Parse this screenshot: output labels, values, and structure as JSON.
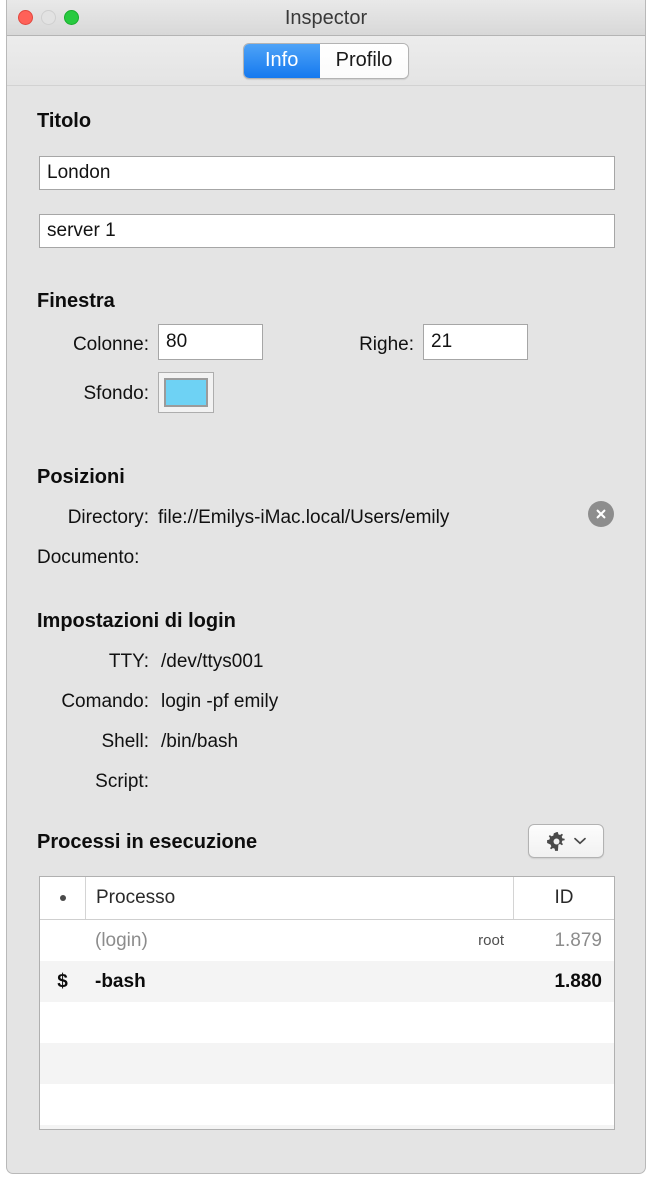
{
  "window": {
    "title": "Inspector",
    "controls": {
      "close": "close-button",
      "minimize": "minimize-button",
      "zoom": "zoom-button"
    }
  },
  "tabs": [
    {
      "label": "Info",
      "selected": true
    },
    {
      "label": "Profilo",
      "selected": false
    }
  ],
  "sections": {
    "title": {
      "heading": "Titolo",
      "field_name": "London",
      "field_profile": "server 1"
    },
    "window_settings": {
      "heading": "Finestra",
      "columns_label": "Colonne:",
      "columns_value": "80",
      "rows_label": "Righe:",
      "rows_value": "21",
      "background_label": "Sfondo:",
      "background_color": "#6ed2f4"
    },
    "locations": {
      "heading": "Posizioni",
      "directory_label": "Directory:",
      "directory_value": "file://Emilys-iMac.local/Users/emily",
      "document_label": "Documento:",
      "document_value": ""
    },
    "login": {
      "heading": "Impostazioni di login",
      "tty_label": "TTY:",
      "tty_value": "/dev/ttys001",
      "command_label": "Comando:",
      "command_value": "login -pf emily",
      "shell_label": "Shell:",
      "shell_value": "/bin/bash",
      "script_label": "Script:",
      "script_value": ""
    },
    "processes": {
      "heading": "Processi in esecuzione",
      "action_menu": "gear-icon",
      "columns": {
        "marker": "•",
        "name": "Processo",
        "id": "ID"
      },
      "rows": [
        {
          "marker": "",
          "name": "(login)",
          "user": "root",
          "id": "1.879",
          "bold": false
        },
        {
          "marker": "$",
          "name": "-bash",
          "user": "",
          "id": "1.880",
          "bold": true
        },
        {
          "marker": "",
          "name": "",
          "user": "",
          "id": "",
          "bold": false
        },
        {
          "marker": "",
          "name": "",
          "user": "",
          "id": "",
          "bold": false
        },
        {
          "marker": "",
          "name": "",
          "user": "",
          "id": "",
          "bold": false
        },
        {
          "marker": "",
          "name": "",
          "user": "",
          "id": "",
          "bold": false
        }
      ]
    }
  },
  "colors": {
    "accent": "#1579ef",
    "window_bg": "#e4e4e4",
    "swatch": "#6ed2f4"
  }
}
